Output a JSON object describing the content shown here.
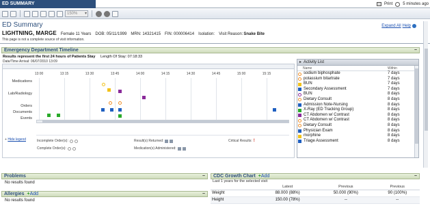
{
  "window": {
    "title": "ED SUMMARY",
    "print_label": "Print",
    "refresh_label": "5 minutes ago"
  },
  "toolbar": {
    "zoom_value": "150%"
  },
  "header": {
    "title": "ED Summary",
    "expand_all": "Expand All",
    "help": "Help"
  },
  "patient": {
    "name": "LIGHTNING, MARGE",
    "demographics": "Female 11 Years",
    "dob": "DOB: 05/11/1999",
    "mrn": "MRN: 14321415",
    "fin": "FIN: 000006414",
    "isolation": "Isolation:",
    "visit_reason_label": "Visit Reason:",
    "visit_reason": "Snake Bite",
    "note": "This page is not a complete source of visit information."
  },
  "timeline": {
    "title": "Emergency Department Timeline",
    "subtitle": "Results represent the first 24 hours of Patients Stay",
    "length_of_stay": "Length Of Stay: 07:18:33",
    "arrival": "Date/Time Arrival: 06/07/2010 13:09",
    "ticks": [
      "13:00",
      "13:15",
      "13:30",
      "13:45",
      "14:00",
      "14:15",
      "14:30",
      "14:45",
      "15:00",
      "15:15"
    ],
    "rows": [
      "Medications",
      "Lab/Radiology",
      "Orders",
      "Documents",
      "Events"
    ],
    "hide_legend": "Hide legend",
    "legend": {
      "incomplete_orders": "Incomplete Order(s):",
      "complete_orders": "Complete Order(s):",
      "results_returned": "Result(s) Returned:",
      "medications_administered": "Medication(s) Administered:",
      "critical_results": "Critical Results:"
    },
    "colors": {
      "orange": "#f0902a",
      "yellow": "#f2c21c",
      "purple": "#8a2a9a",
      "blue": "#1f5fc0",
      "green": "#2aaa2a",
      "red": "#d03020"
    }
  },
  "activity_list": {
    "title": "Activity List",
    "col_name": "Name",
    "col_within": "Within",
    "items": [
      {
        "name": "sodium biphosphate",
        "within": "7 days",
        "icon": "orange-circle"
      },
      {
        "name": "potassium bitartrate",
        "within": "7 days",
        "icon": "orange-circle"
      },
      {
        "name": "BUN",
        "within": "7 days",
        "icon": "yellow-square"
      },
      {
        "name": "Secondary Assessment",
        "within": "7 days",
        "icon": "blue-square"
      },
      {
        "name": "BUN",
        "within": "8 days",
        "icon": "purple-circle"
      },
      {
        "name": "Dietary Consult",
        "within": "8 days",
        "icon": "orange-circle"
      },
      {
        "name": "Admission Note-Nursing",
        "within": "8 days",
        "icon": "blue-square"
      },
      {
        "name": "X-Ray (ED Tracking Group)",
        "within": "8 days",
        "icon": "green-square"
      },
      {
        "name": "CT Abdomen w/ Contrast",
        "within": "8 days",
        "icon": "purple-square"
      },
      {
        "name": "CT Abdomen w/ Contrast",
        "within": "8 days",
        "icon": "orange-circle"
      },
      {
        "name": "Dietary Consult",
        "within": "8 days",
        "icon": "orange-circle"
      },
      {
        "name": "Physician Exam",
        "within": "8 days",
        "icon": "blue-square"
      },
      {
        "name": "morphine",
        "within": "8 days",
        "icon": "yellow-square"
      },
      {
        "name": "Triage Assessment",
        "within": "8 days",
        "icon": "blue-square"
      }
    ]
  },
  "problems": {
    "title": "Problems",
    "empty": "No results found"
  },
  "allergies": {
    "title": "Allergies",
    "add": "Add",
    "empty": "No results found"
  },
  "growth_chart": {
    "title": "CDC Growth Chart",
    "add": "Add",
    "subtitle": "Last 1 years for the selected visit",
    "columns": [
      "",
      "Latest",
      "Previous",
      "Previous"
    ],
    "rows": [
      {
        "label": "Weight",
        "latest": "88.000 (88%)",
        "prev1": "50.000 (90%)",
        "prev2": "90 (100%)"
      },
      {
        "label": "Height",
        "latest": "150.00 (78%)",
        "prev1": "--",
        "prev2": "--"
      }
    ]
  }
}
